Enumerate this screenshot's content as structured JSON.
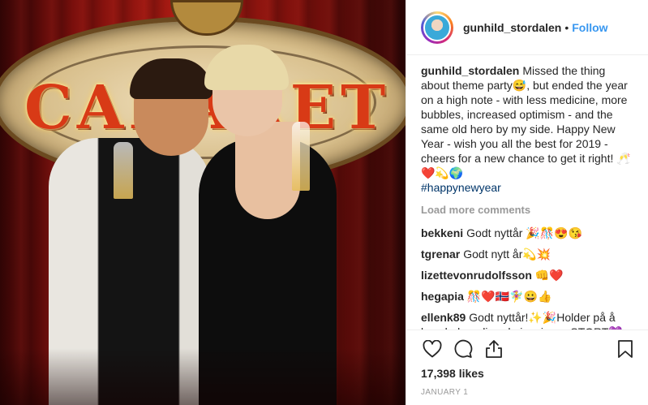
{
  "post": {
    "username": "gunhild_stordalen",
    "follow_label": "Follow",
    "separator": "•",
    "photo": {
      "sign_text": "CABARET"
    },
    "caption": {
      "username": "gunhild_stordalen",
      "text": "Missed the thing about theme party😅, but ended the year on a high note - with less medicine, more bubbles, increased optimism - and the same old hero by my side. Happy New Year - wish you all the best for 2019 - cheers for a new chance to get it right! 🥂❤️💫🌍",
      "hashtag": "#happynewyear"
    },
    "load_more_label": "Load more comments",
    "comments": [
      {
        "username": "bekkeni",
        "text": "Godt nyttår 🎉🎊😍😘"
      },
      {
        "username": "tgrenar",
        "text": "Godt nytt år💫💥"
      },
      {
        "username": "lizettevonrudolfsson",
        "text": "👊❤️"
      },
      {
        "username": "hegapia",
        "text": "🎊❤️🇳🇴🧚‍♀️😀👍"
      },
      {
        "username": "ellenk89",
        "text": "Godt nyttår!✨🎉Holder på å lese boken din - du inspirerer STORT💜 pågangsmotet ditt og alt du gjør for klima, miljø og helse er virkelig beundringsverdig! 💖"
      }
    ],
    "likes": "17,398 likes",
    "date": "JANUARY 1",
    "icons": {
      "like": "heart-icon",
      "comment": "comment-icon",
      "share": "share-icon",
      "save": "bookmark-icon"
    },
    "colors": {
      "accent": "#3897f0",
      "hashtag": "#003569",
      "muted": "#999999"
    }
  }
}
